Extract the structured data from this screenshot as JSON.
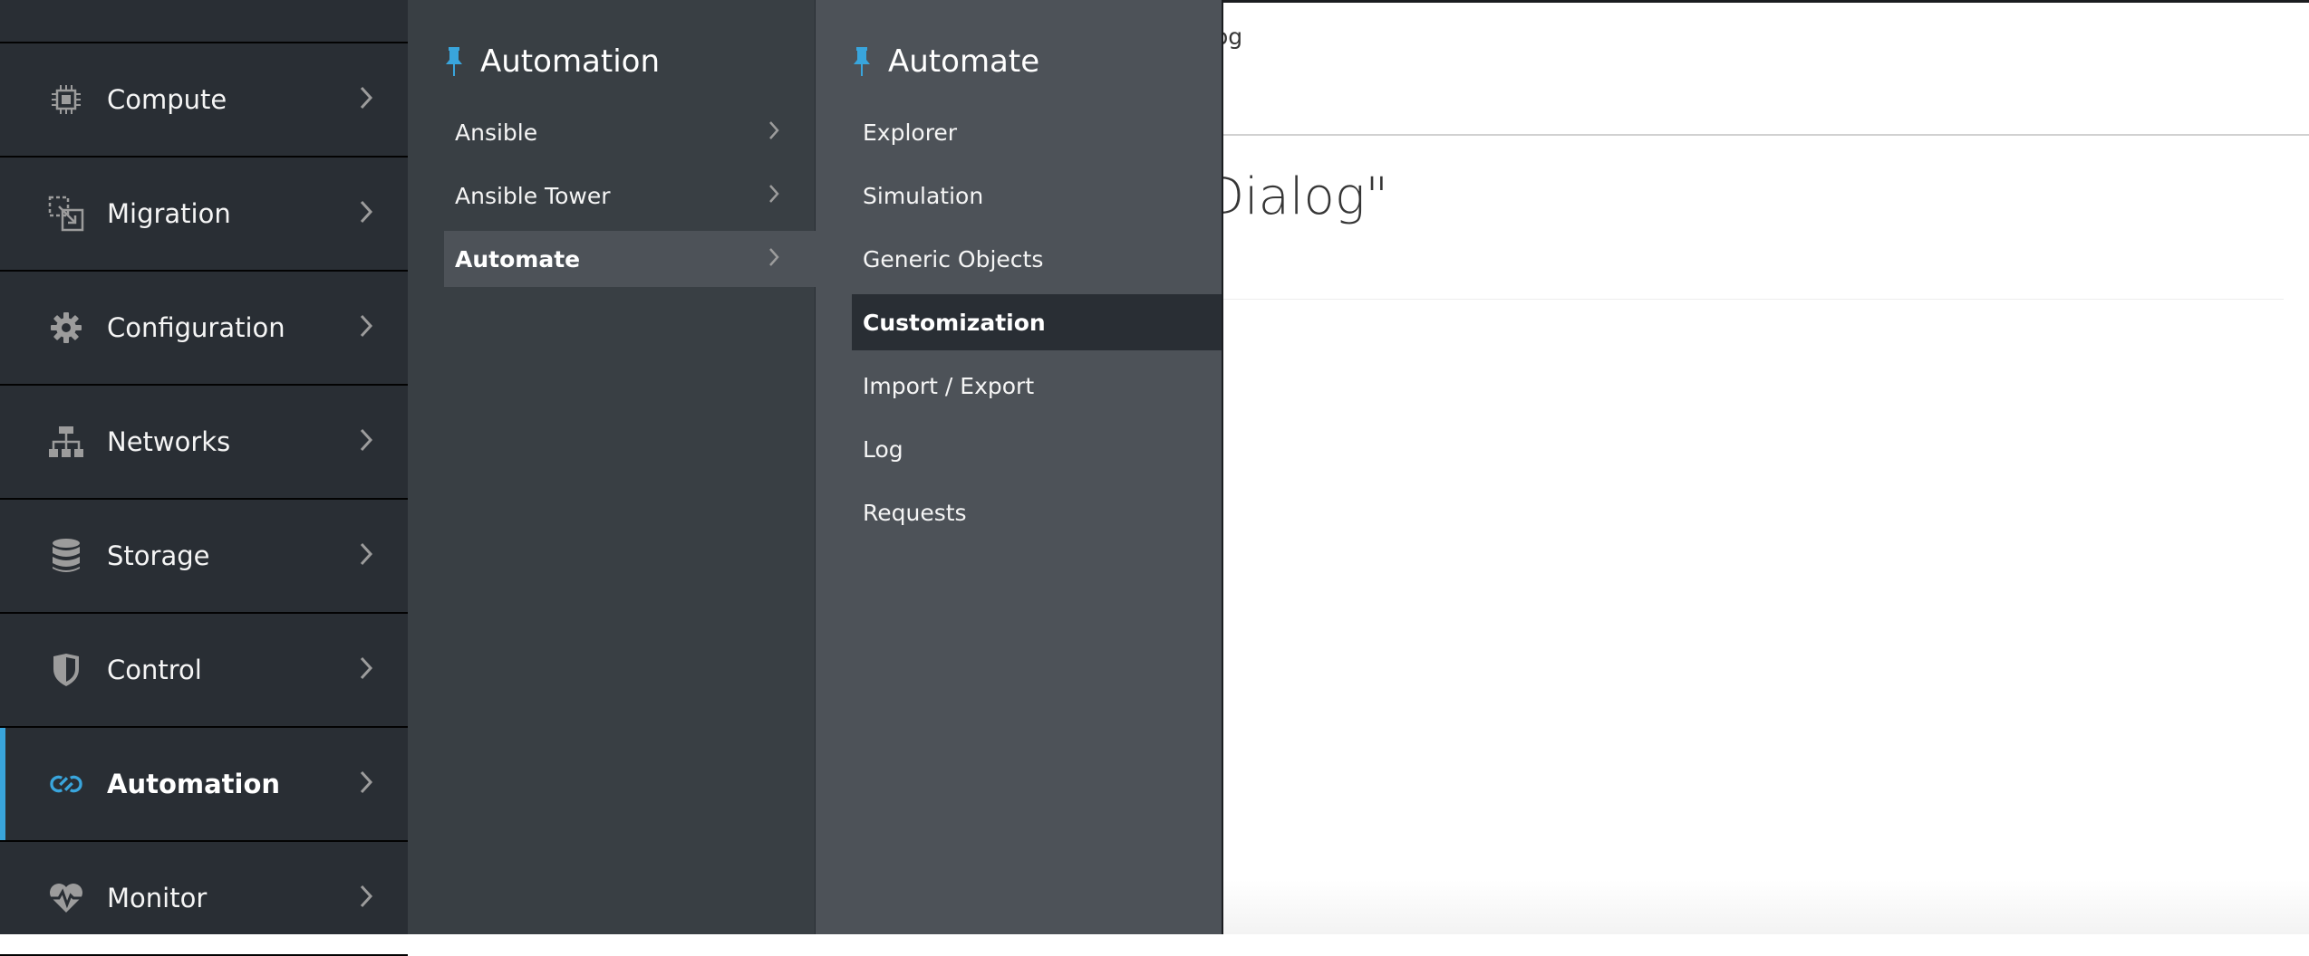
{
  "background": {
    "breadcrumb_fragment": "og",
    "title_fragment": "Dialog\""
  },
  "primary_nav": {
    "items": [
      {
        "label": "Compute",
        "icon": "chip-icon"
      },
      {
        "label": "Migration",
        "icon": "migration-icon"
      },
      {
        "label": "Configuration",
        "icon": "gear-icon"
      },
      {
        "label": "Networks",
        "icon": "network-icon"
      },
      {
        "label": "Storage",
        "icon": "database-icon"
      },
      {
        "label": "Control",
        "icon": "shield-icon"
      },
      {
        "label": "Automation",
        "icon": "automation-icon",
        "active": true
      },
      {
        "label": "Monitor",
        "icon": "heartbeat-icon"
      }
    ]
  },
  "secondary_nav": {
    "title": "Automation",
    "items": [
      {
        "label": "Ansible"
      },
      {
        "label": "Ansible Tower"
      },
      {
        "label": "Automate",
        "selected": true
      }
    ]
  },
  "tertiary_nav": {
    "title": "Automate",
    "items": [
      {
        "label": "Explorer"
      },
      {
        "label": "Simulation"
      },
      {
        "label": "Generic Objects"
      },
      {
        "label": "Customization",
        "active": true
      },
      {
        "label": "Import / Export"
      },
      {
        "label": "Log"
      },
      {
        "label": "Requests"
      }
    ]
  },
  "colors": {
    "primary_nav_bg": "#292e34",
    "secondary_nav_bg": "#393f44",
    "tertiary_nav_bg": "#4d5258",
    "accent_blue": "#39a5dc",
    "icon_gray": "#9c9c9c"
  }
}
